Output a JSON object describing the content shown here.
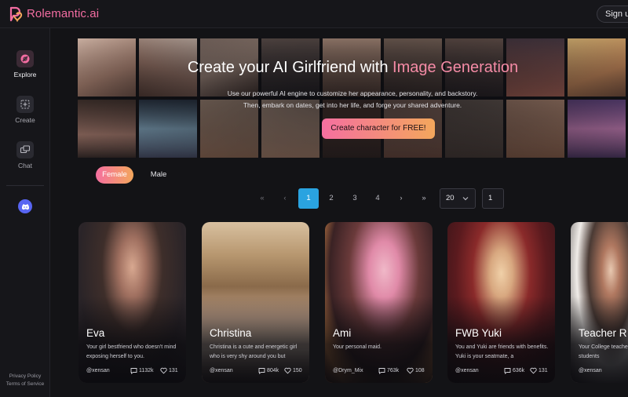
{
  "app": {
    "name": "Rolemantic.ai",
    "brand_color": "#f36da2",
    "signup_label": "Sign up"
  },
  "sidebar": {
    "items": [
      {
        "label": "Explore",
        "icon": "explore-icon",
        "active": true
      },
      {
        "label": "Create",
        "icon": "create-icon",
        "active": false
      },
      {
        "label": "Chat",
        "icon": "chat-icon",
        "active": false
      }
    ],
    "discord_icon": "discord-icon",
    "footer": [
      "Privacy Policy",
      "Terms of Service"
    ]
  },
  "hero": {
    "title_prefix": "Create your AI Girlfriend with ",
    "title_accent": "Image Generation",
    "subtitle": "Use our powerful AI engine to customize her appearance, personality, and backstory. Then, embark on dates, get into her life, and forge your shared adventure.",
    "cta_label": "Create character for FREE!"
  },
  "gender_tabs": [
    {
      "label": "Female",
      "active": true
    },
    {
      "label": "Male",
      "active": false
    }
  ],
  "pagination": {
    "first": "«",
    "prev": "‹",
    "pages": [
      "1",
      "2",
      "3",
      "4"
    ],
    "current": "1",
    "next": "›",
    "last": "»",
    "page_size": "20",
    "jump_value": "1"
  },
  "cards": [
    {
      "name": "Eva",
      "description": "Your girl bestfriend who doesn't mind exposing herself to you.",
      "author": "@xensan",
      "messages": "1132k",
      "likes": "131"
    },
    {
      "name": "Christina",
      "description": "Christina is a cute and energetic girl who is very shy around you but",
      "author": "@xensan",
      "messages": "804k",
      "likes": "150"
    },
    {
      "name": "Ami",
      "description": "Your personal maid.",
      "author": "@Drym_Mix",
      "messages": "763k",
      "likes": "108"
    },
    {
      "name": "FWB Yuki",
      "description": "You and Yuki are friends with benefits. Yuki is your seatmate, a",
      "author": "@xensan",
      "messages": "636k",
      "likes": "131"
    },
    {
      "name": "Teacher R",
      "description": "Your College teacher who is strict to her students",
      "author": "@xensan",
      "messages": "",
      "likes": ""
    }
  ],
  "colors": {
    "accent_gradient_start": "#f56fa0",
    "accent_gradient_end": "#f3a75c",
    "pagination_active": "#2aa3e0",
    "background": "#131316"
  }
}
